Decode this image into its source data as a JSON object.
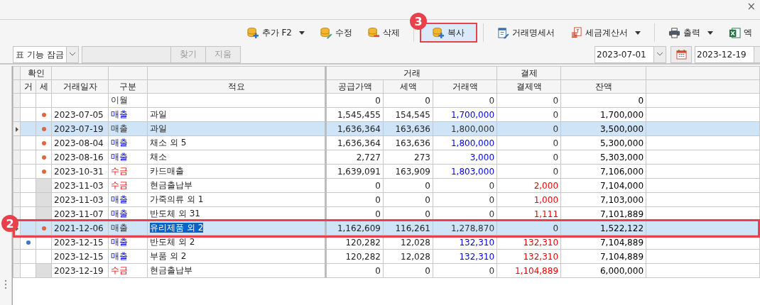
{
  "window": {
    "close": "×"
  },
  "toolbar": {
    "buttons": [
      {
        "label": "추가 F2",
        "kind": "add",
        "dropdown": true
      },
      {
        "label": "수정",
        "kind": "edit",
        "dropdown": false
      },
      {
        "label": "삭제",
        "kind": "remove",
        "dropdown": false
      },
      {
        "kind": "separator"
      },
      {
        "label": "복사",
        "kind": "copy",
        "dropdown": false,
        "callout": "3"
      },
      {
        "kind": "separator"
      },
      {
        "label": "거래명세서",
        "kind": "statement",
        "dropdown": false
      },
      {
        "label": "세금계산서",
        "kind": "invoice",
        "dropdown": true
      },
      {
        "kind": "separator"
      },
      {
        "label": "출력",
        "kind": "print",
        "dropdown": true
      },
      {
        "label": "엑",
        "kind": "excel",
        "dropdown": false
      }
    ]
  },
  "filter": {
    "lock_select": "표 기능 잠금",
    "find_button": {
      "label": "찾기",
      "disabled": true
    },
    "clear_button": {
      "label": "지움",
      "disabled": true
    },
    "date_from": "2023-07-01",
    "date_to": "2023-12-19"
  },
  "table": {
    "column_groups": [
      {
        "label": "확인",
        "columns": [
          "거",
          "세"
        ]
      },
      {
        "columns": [
          "거래일자"
        ]
      },
      {
        "columns": [
          "구분"
        ]
      },
      {
        "columns": [
          "적요"
        ]
      },
      {
        "label": "거래",
        "columns": [
          "공급가액",
          "세액",
          "거래액"
        ]
      },
      {
        "label": "결제",
        "columns": [
          "결제액"
        ]
      },
      {
        "columns": [
          "잔액"
        ]
      }
    ],
    "rows": [
      {
        "trade_check": false,
        "tax_check": false,
        "tax_cell_disabled": false,
        "type": "이월",
        "kind": "carryover",
        "supply": "0",
        "tax": "0",
        "amount": "0",
        "paid": "0",
        "balance": "0",
        "selected": false
      },
      {
        "trade_check": false,
        "tax_check": true,
        "tax_cell_disabled": false,
        "date": "2023-07-05",
        "type": "매출",
        "kind": "sales",
        "description": "과일",
        "supply": "1,545,455",
        "tax": "154,545",
        "amount": "1,700,000",
        "paid": "0",
        "balance": "1,700,000",
        "selected": false
      },
      {
        "trade_check": false,
        "tax_check": true,
        "tax_cell_disabled": false,
        "date": "2023-07-19",
        "type": "매출",
        "kind": "sales",
        "description": "과일",
        "supply": "1,636,364",
        "tax": "163,636",
        "amount": "1,800,000",
        "paid": "0",
        "balance": "3,500,000",
        "selected": true
      },
      {
        "trade_check": false,
        "tax_check": true,
        "tax_cell_disabled": false,
        "date": "2023-08-04",
        "type": "매출",
        "kind": "sales",
        "description": "채소 외 5",
        "supply": "1,636,364",
        "tax": "163,636",
        "amount": "1,800,000",
        "paid": "0",
        "balance": "5,300,000",
        "selected": false
      },
      {
        "trade_check": false,
        "tax_check": true,
        "tax_cell_disabled": false,
        "date": "2023-08-16",
        "type": "매출",
        "kind": "sales",
        "description": "채소",
        "supply": "2,727",
        "tax": "273",
        "amount": "3,000",
        "paid": "0",
        "balance": "5,303,000",
        "selected": false
      },
      {
        "trade_check": false,
        "tax_check": true,
        "tax_cell_disabled": false,
        "date": "2023-10-31",
        "type": "수금",
        "kind": "receipt",
        "description": "카드매출",
        "supply": "1,639,091",
        "tax": "163,909",
        "amount": "1,803,000",
        "paid": "0",
        "balance": "7,106,000",
        "selected": false
      },
      {
        "trade_check": false,
        "tax_check": false,
        "tax_cell_disabled": true,
        "date": "2023-11-03",
        "type": "수금",
        "kind": "receipt",
        "description": "현금출납부",
        "supply": "0",
        "tax": "0",
        "amount": "0",
        "paid": "2,000",
        "balance": "7,104,000",
        "selected": false
      },
      {
        "trade_check": false,
        "tax_check": false,
        "tax_cell_disabled": true,
        "date": "2023-11-03",
        "type": "매출",
        "kind": "sales",
        "description": "가죽의류 외 1",
        "supply": "0",
        "tax": "0",
        "amount": "0",
        "paid": "1,000",
        "balance": "7,103,000",
        "selected": false
      },
      {
        "trade_check": false,
        "tax_check": false,
        "tax_cell_disabled": true,
        "date": "2023-11-07",
        "type": "매출",
        "kind": "sales",
        "description": "반도체 외 31",
        "supply": "0",
        "tax": "0",
        "amount": "0",
        "paid": "1,111",
        "balance": "7,101,889",
        "selected": false
      },
      {
        "trade_check": false,
        "tax_check": true,
        "tax_cell_disabled": false,
        "date": "2021-12-06",
        "type": "매출",
        "kind": "sales",
        "description": "유리제품 외 2",
        "supply": "1,162,609",
        "tax": "116,261",
        "amount": "1,278,870",
        "paid": "0",
        "balance": "1,522,122",
        "selected": true,
        "editing": true,
        "callout": "2"
      },
      {
        "trade_check": true,
        "tax_check": false,
        "tax_cell_disabled": false,
        "date": "2023-12-15",
        "type": "매출",
        "kind": "sales",
        "description": "반도체 외 2",
        "supply": "120,282",
        "tax": "12,028",
        "amount": "132,310",
        "paid": "132,310",
        "balance": "7,104,889",
        "selected": false
      },
      {
        "trade_check": false,
        "tax_check": false,
        "tax_cell_disabled": false,
        "date": "2023-12-15",
        "type": "매출",
        "kind": "sales",
        "description": "부품 외 2",
        "supply": "120,282",
        "tax": "12,028",
        "amount": "132,310",
        "paid": "132,310",
        "balance": "7,104,889",
        "selected": false
      },
      {
        "trade_check": false,
        "tax_check": false,
        "tax_cell_disabled": true,
        "date": "2023-12-19",
        "type": "수금",
        "kind": "receipt",
        "description": "현금출납부",
        "supply": "0",
        "tax": "0",
        "amount": "0",
        "paid": "1,104,889",
        "balance": "6,000,000",
        "selected": false
      }
    ]
  }
}
